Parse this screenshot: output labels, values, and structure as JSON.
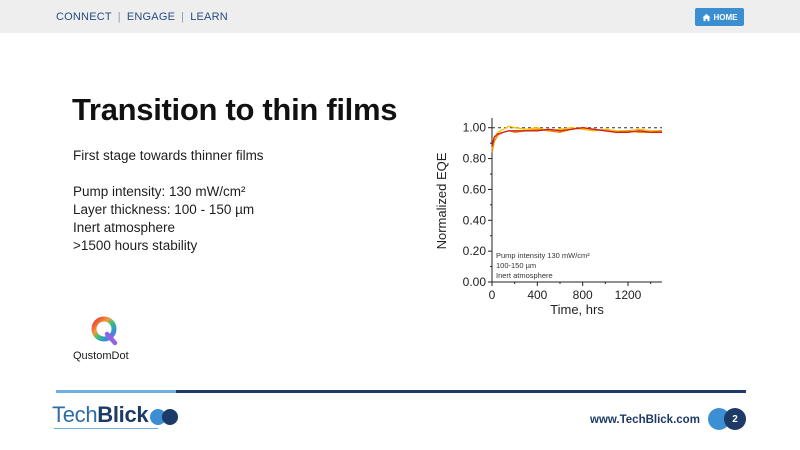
{
  "nav": {
    "items": [
      "CONNECT",
      "ENGAGE",
      "LEARN"
    ],
    "home_label": "HOME"
  },
  "slide": {
    "title": "Transition to thin films",
    "bullets": [
      "First stage towards thinner films",
      "Pump intensity: 130 mW/cm²",
      "Layer thickness: 100 - 150 µm",
      "Inert atmosphere",
      ">1500 hours stability"
    ],
    "logo_name": "QustomDot"
  },
  "chart_data": {
    "type": "line",
    "xlabel": "Time, hrs",
    "ylabel": "Normalized EQE",
    "xlim": [
      0,
      1500
    ],
    "ylim": [
      0,
      1.05
    ],
    "xticks": [
      0,
      400,
      800,
      1200
    ],
    "yticks": [
      "0.00",
      "0.20",
      "0.40",
      "0.60",
      "0.80",
      "1.00"
    ],
    "reference_line": 1.0,
    "annotation": [
      "Pump intensity 130 mW/cm²",
      "100-150 µm",
      "Inert atmosphere"
    ],
    "series": [
      {
        "color": "#f2c200",
        "x": [
          0,
          20,
          50,
          100,
          150,
          200,
          300,
          400,
          500,
          600,
          700,
          800,
          900,
          1000,
          1100,
          1200,
          1300,
          1400,
          1500
        ],
        "values": [
          0.86,
          0.93,
          0.97,
          0.99,
          1.01,
          1.0,
          0.99,
          1.0,
          0.98,
          0.99,
          1.0,
          0.99,
          0.98,
          0.99,
          0.98,
          0.98,
          0.99,
          0.98,
          0.98
        ]
      },
      {
        "color": "#f08a00",
        "x": [
          0,
          20,
          50,
          100,
          150,
          200,
          300,
          400,
          500,
          600,
          700,
          800,
          900,
          1000,
          1100,
          1200,
          1300,
          1400,
          1500
        ],
        "values": [
          0.84,
          0.91,
          0.95,
          0.97,
          0.98,
          0.97,
          0.98,
          0.99,
          0.98,
          0.97,
          0.99,
          1.0,
          0.99,
          0.98,
          0.97,
          0.98,
          0.97,
          0.97,
          0.98
        ]
      },
      {
        "color": "#d01f1f",
        "x": [
          0,
          20,
          50,
          100,
          150,
          200,
          300,
          400,
          500,
          600,
          700,
          800,
          900,
          1000,
          1100,
          1200,
          1300,
          1400,
          1500
        ],
        "values": [
          0.88,
          0.94,
          0.96,
          0.97,
          0.98,
          0.98,
          0.98,
          0.98,
          0.99,
          0.98,
          0.99,
          1.0,
          0.99,
          0.98,
          0.97,
          0.97,
          0.98,
          0.97,
          0.97
        ]
      }
    ]
  },
  "footer": {
    "brand_tech": "Tech",
    "brand_blick": "Blick",
    "url": "www.TechBlick.com",
    "page_number": "2"
  },
  "colors": {
    "nav_text": "#2a4a7f",
    "home_button": "#3b8fd0",
    "brand_dark": "#1e3a66",
    "brand_light": "#3d8fd4"
  }
}
